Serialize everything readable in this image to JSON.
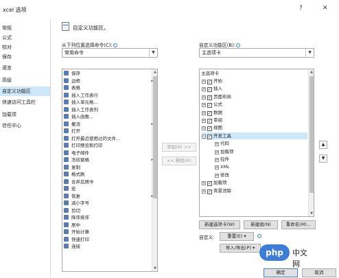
{
  "window": {
    "title": "xcel 选项",
    "help": "?",
    "close": "✕"
  },
  "sidebar": {
    "items": [
      {
        "label": "常规"
      },
      {
        "label": "公式"
      },
      {
        "label": "校对"
      },
      {
        "label": "保存"
      },
      {
        "label": "语言"
      },
      {
        "label": "高级"
      },
      {
        "label": "自定义功能区",
        "active": true
      },
      {
        "label": "快速访问工具栏"
      },
      {
        "label": "加载项"
      },
      {
        "label": "信任中心"
      }
    ]
  },
  "main": {
    "heading": "自定义功能区。",
    "left": {
      "label": "从下列位置选择命令(C):",
      "dropdown_value": "常用命令",
      "commands": [
        {
          "label": "保存"
        },
        {
          "label": "边框",
          "sub": "▸"
        },
        {
          "label": "表格"
        },
        {
          "label": "插入工作表行"
        },
        {
          "label": "插入单元格..."
        },
        {
          "label": "插入工作表列"
        },
        {
          "label": "插入函数..."
        },
        {
          "label": "撤消",
          "sub": "▸"
        },
        {
          "label": "打开"
        },
        {
          "label": "打开最近使用过的文件..."
        },
        {
          "label": "打印预览和打印"
        },
        {
          "label": "电子邮件"
        },
        {
          "label": "冻结窗格",
          "sub": "▸"
        },
        {
          "label": "复制"
        },
        {
          "label": "格式刷"
        },
        {
          "label": "合并后居中"
        },
        {
          "label": "宏"
        },
        {
          "label": "恢复",
          "sub": "▸"
        },
        {
          "label": "减小字号"
        },
        {
          "label": "剪切"
        },
        {
          "label": "降序排序"
        },
        {
          "label": "居中"
        },
        {
          "label": "开始计算"
        },
        {
          "label": "快速打印"
        },
        {
          "label": "连接"
        }
      ]
    },
    "middle": {
      "add_label": "添加(A) >>",
      "remove_label": "<< 删除(R)"
    },
    "right": {
      "label": "自定义功能区(B):",
      "dropdown_value": "主选项卡",
      "tree_header": "主选项卡",
      "tree": [
        {
          "label": "开始",
          "level": 1,
          "expander": "+",
          "checked": true
        },
        {
          "label": "插入",
          "level": 1,
          "expander": "+",
          "checked": true
        },
        {
          "label": "页面布局",
          "level": 1,
          "expander": "+",
          "checked": true
        },
        {
          "label": "公式",
          "level": 1,
          "expander": "+",
          "checked": true
        },
        {
          "label": "数据",
          "level": 1,
          "expander": "+",
          "checked": true
        },
        {
          "label": "审阅",
          "level": 1,
          "expander": "+",
          "checked": true
        },
        {
          "label": "视图",
          "level": 1,
          "expander": "+",
          "checked": true
        },
        {
          "label": "开发工具",
          "level": 1,
          "expander": "−",
          "checked": true,
          "selected": true
        },
        {
          "label": "代码",
          "level": 2,
          "expander": "+"
        },
        {
          "label": "加载项",
          "level": 2,
          "expander": "+"
        },
        {
          "label": "控件",
          "level": 2,
          "expander": "+"
        },
        {
          "label": "XML",
          "level": 2,
          "expander": "+"
        },
        {
          "label": "修改",
          "level": 2,
          "expander": "+"
        },
        {
          "label": "加载项",
          "level": 1,
          "expander": "+",
          "checked": true
        },
        {
          "label": "背景消除",
          "level": 1,
          "expander": "+",
          "checked": true
        }
      ],
      "new_tab_label": "新建选项卡(W)",
      "new_group_label": "新建组(N)",
      "rename_label": "重命名(M)...",
      "customize_label": "自定义:",
      "reset_label": "重置(E) ▾",
      "import_export_label": "导入/导出(P) ▾"
    },
    "move_up": "▲",
    "move_down": "▼"
  },
  "footer": {
    "ok_label": "确定",
    "cancel_label": "取消"
  },
  "watermark": {
    "logo_text": "php",
    "text": "中文网"
  },
  "icons": {
    "info": "i",
    "scroll_up": "▲",
    "scroll_down": "▼",
    "dropdown": "▼",
    "check": "✓"
  }
}
